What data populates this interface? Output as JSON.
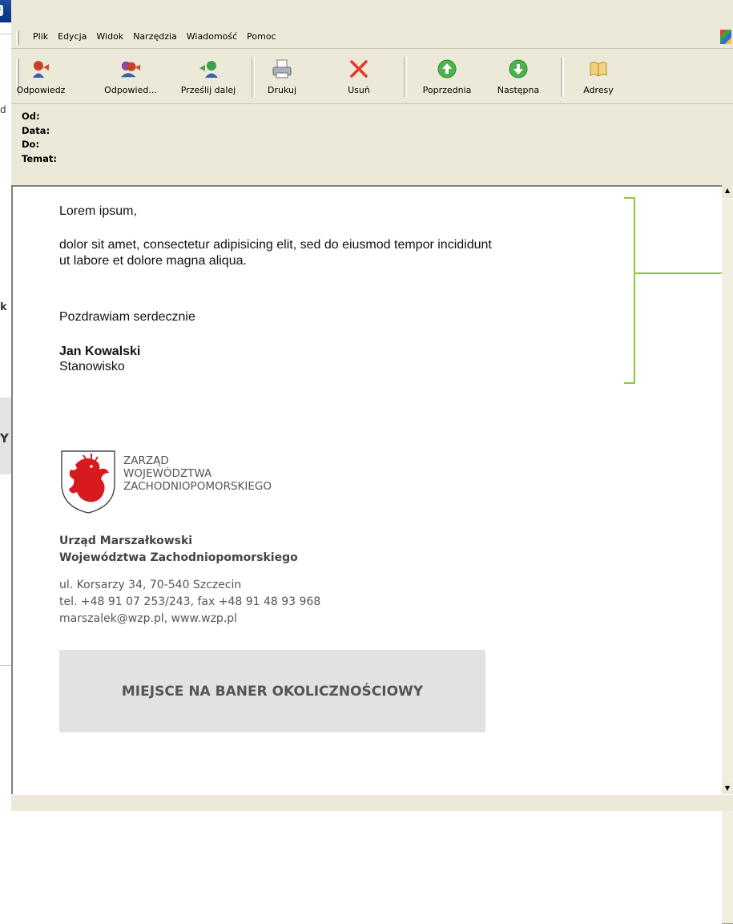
{
  "window": {
    "title": ""
  },
  "menu": [
    "Plik",
    "Edycja",
    "Widok",
    "Narzędzia",
    "Wiadomość",
    "Pomoc"
  ],
  "toolbar": [
    {
      "label": "Odpowiedz",
      "icon": "reply-icon"
    },
    {
      "label": "Odpowied...",
      "icon": "reply-all-icon"
    },
    {
      "label": "Prześlij dalej",
      "icon": "forward-icon"
    },
    {
      "label": "Drukuj",
      "icon": "print-icon"
    },
    {
      "label": "Usuń",
      "icon": "delete-icon"
    },
    {
      "label": "Poprzednia",
      "icon": "previous-icon"
    },
    {
      "label": "Następna",
      "icon": "next-icon"
    },
    {
      "label": "Adresy",
      "icon": "address-book-icon"
    }
  ],
  "headers": {
    "from": "Od:",
    "date": "Data:",
    "to": "Do:",
    "subject": "Temat:"
  },
  "message": {
    "greeting": "Lorem ipsum,",
    "body_line1": "dolor sit amet, consectetur adipisicing elit, sed do eiusmod tempor incididunt",
    "body_line2": "ut labore et dolore magna aliqua.",
    "closing": "Pozdrawiam serdecznie",
    "sender_name": "Jan Kowalski",
    "sender_position": "Stanowisko"
  },
  "signature": {
    "org_line1": "ZARZĄD",
    "org_line2": "WOJEWÓDZTWA",
    "org_line3": "ZACHODNIOPOMORSKIEGO",
    "office_line1": "Urząd Marszałkowski",
    "office_line2": "Województwa Zachodniopomorskiego",
    "address": "ul. Korsarzy 34, 70-540 Szczecin",
    "phone": "tel. +48 91 07 253/243, fax +48 91 48 93 968",
    "email_www": "marszalek@wzp.pl, www.wzp.pl",
    "banner": "MIEJSCE NA BANER OKOLICZNOŚCIOWY"
  },
  "background_fragments": [
    "d",
    "k",
    "Y"
  ],
  "colors": {
    "bracket": "#8dc63f",
    "banner_bg": "#e1e2e4",
    "crest_red": "#d71920",
    "titlebar": "#0a3a8f"
  }
}
